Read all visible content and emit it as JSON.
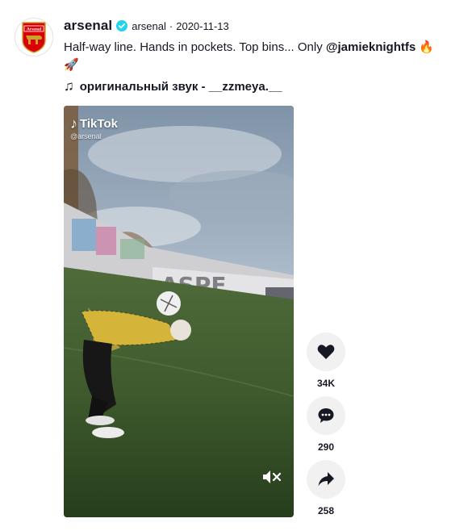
{
  "author": {
    "display_name": "arsenal",
    "handle": "arsenal",
    "date": "2020-11-13"
  },
  "caption": {
    "text": "Half-way line. Hands in pockets. Top bins... Only ",
    "mention": "@jamieknightfs",
    "emoji_1": "🔥",
    "emoji_2": "🚀"
  },
  "music": {
    "label": "оригинальный звук - __zzmeya.__"
  },
  "video": {
    "watermark_brand": "TikTok",
    "watermark_handle": "@arsenal"
  },
  "actions": {
    "likes": "34K",
    "comments": "290",
    "shares": "258"
  },
  "colors": {
    "verified": "#20d5ec",
    "arsenal_red": "#db0007"
  }
}
